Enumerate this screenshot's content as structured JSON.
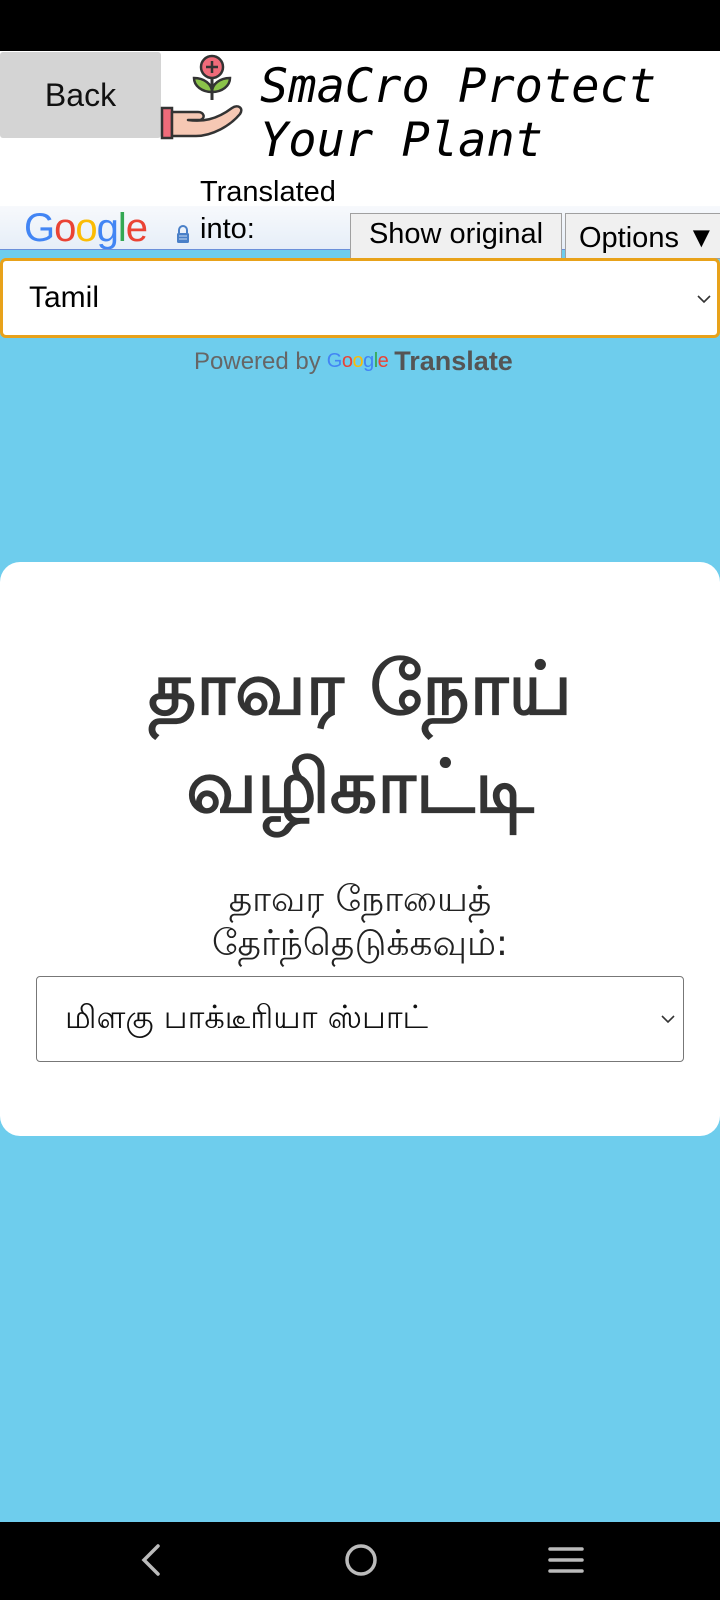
{
  "header": {
    "back_label": "Back",
    "title": "SmaCro Protect Your Plant"
  },
  "translate_bar": {
    "logo_text": "Google",
    "translated_into_line1": "Translated",
    "translated_into_line2": "into:",
    "show_original_label": "Show original",
    "options_label": "Options ▼",
    "selected_language": "Tamil",
    "powered_by_label": "Powered by",
    "powered_google": "Google",
    "powered_translate": "Translate"
  },
  "main": {
    "title": "தாவர நோய் வழிகாட்டி",
    "select_label": "தாவர நோயைத் தேர்ந்தெடுக்கவும்:",
    "selected_disease": "மிளகு பாக்டீரியா ஸ்பாட்"
  },
  "colors": {
    "background": "#6ecded",
    "card": "#ffffff",
    "select_focus_border": "#e8a21a"
  },
  "icons": {
    "logo": "hand-holding-plant-icon",
    "lock": "lock-icon",
    "dropdown": "chevron-down-icon",
    "nav_back": "nav-back-icon",
    "nav_home": "nav-home-icon",
    "nav_menu": "nav-menu-icon"
  }
}
